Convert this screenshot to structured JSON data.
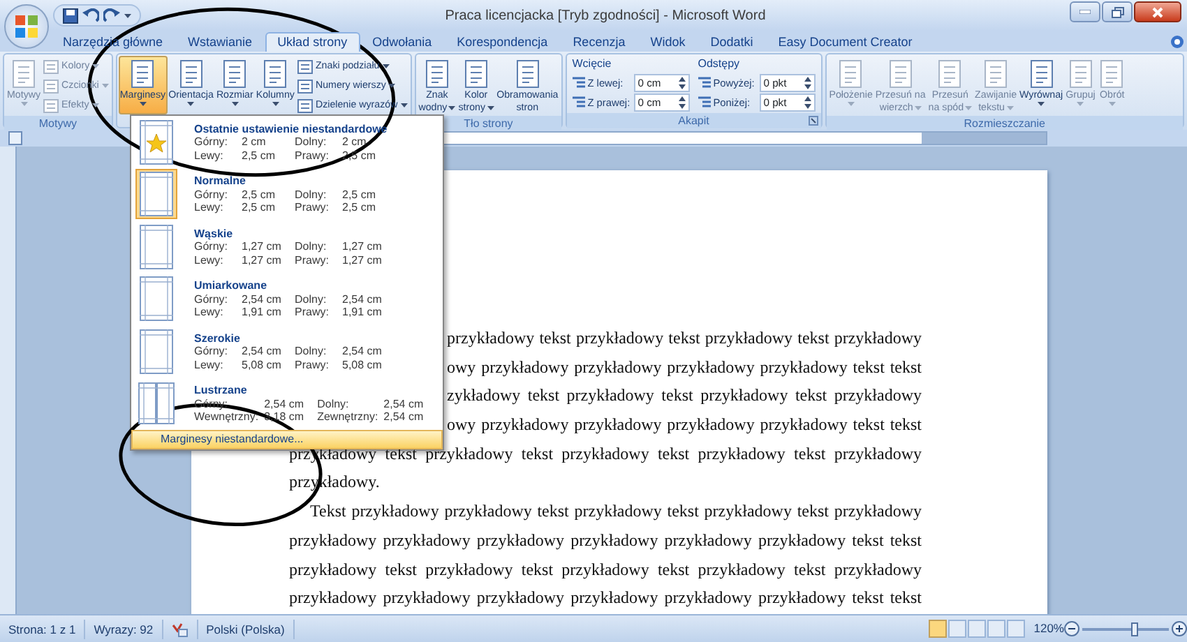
{
  "window": {
    "title": "Praca licencjacka [Tryb zgodności] - Microsoft Word"
  },
  "tabs": [
    {
      "label": "Narzędzia główne",
      "selected": false
    },
    {
      "label": "Wstawianie",
      "selected": false
    },
    {
      "label": "Układ strony",
      "selected": true
    },
    {
      "label": "Odwołania",
      "selected": false
    },
    {
      "label": "Korespondencja",
      "selected": false
    },
    {
      "label": "Recenzja",
      "selected": false
    },
    {
      "label": "Widok",
      "selected": false
    },
    {
      "label": "Dodatki",
      "selected": false
    },
    {
      "label": "Easy Document Creator",
      "selected": false
    }
  ],
  "ribbon": {
    "groups": [
      {
        "label": "Motywy",
        "items": [
          {
            "kind": "large",
            "lines": [
              "Motywy"
            ],
            "dropdown": true,
            "disabled": true,
            "selected": false
          },
          {
            "kind": "stack",
            "items": [
              {
                "label": "Kolory",
                "dropdown": true,
                "disabled": true
              },
              {
                "label": "Czcionki",
                "dropdown": true,
                "disabled": true
              },
              {
                "label": "Efekty",
                "dropdown": true,
                "disabled": true
              }
            ]
          }
        ]
      },
      {
        "items": [
          {
            "kind": "large",
            "lines": [
              "Marginesy"
            ],
            "dropdown": true,
            "disabled": false,
            "selected": true
          },
          {
            "kind": "large",
            "lines": [
              "Orientacja"
            ],
            "dropdown": true,
            "disabled": false,
            "selected": false
          },
          {
            "kind": "large",
            "lines": [
              "Rozmiar"
            ],
            "dropdown": true,
            "disabled": false,
            "selected": false
          },
          {
            "kind": "large",
            "lines": [
              "Kolumny"
            ],
            "dropdown": true,
            "disabled": false,
            "selected": false
          },
          {
            "kind": "stack",
            "items": [
              {
                "label": "Znaki podziału",
                "dropdown": true,
                "disabled": false
              },
              {
                "label": "Numery wierszy",
                "dropdown": true,
                "disabled": false
              },
              {
                "label": "Dzielenie wyrazów",
                "dropdown": true,
                "disabled": false
              }
            ]
          }
        ]
      },
      {
        "label": "Tło strony",
        "items": [
          {
            "kind": "large",
            "lines": [
              "Znak",
              "wodny"
            ],
            "dropdown": true,
            "disabled": false,
            "selected": false
          },
          {
            "kind": "large",
            "lines": [
              "Kolor",
              "strony"
            ],
            "dropdown": true,
            "disabled": false,
            "selected": false
          },
          {
            "kind": "large",
            "lines": [
              "Obramowania",
              "stron"
            ],
            "dropdown": false,
            "disabled": false,
            "selected": false
          }
        ]
      },
      {
        "label": "Akapit",
        "launcher": true,
        "items": [
          {
            "kind": "spins",
            "heading": "Wcięcie",
            "items": [
              {
                "label": "Z lewej:",
                "value": "0 cm"
              },
              {
                "label": "Z prawej:",
                "value": "0 cm"
              }
            ]
          },
          {
            "kind": "spins",
            "heading": "Odstępy",
            "items": [
              {
                "label": "Powyżej:",
                "value": "0 pkt"
              },
              {
                "label": "Poniżej:",
                "value": "0 pkt"
              }
            ]
          }
        ]
      },
      {
        "label": "Rozmieszczanie",
        "items": [
          {
            "kind": "large",
            "lines": [
              "Położenie"
            ],
            "dropdown": true,
            "disabled": true,
            "selected": false
          },
          {
            "kind": "large",
            "lines": [
              "Przesuń na",
              "wierzch"
            ],
            "dropdown": true,
            "disabled": true,
            "selected": false
          },
          {
            "kind": "large",
            "lines": [
              "Przesuń",
              "na spód"
            ],
            "dropdown": true,
            "disabled": true,
            "selected": false
          },
          {
            "kind": "large",
            "lines": [
              "Zawijanie",
              "tekstu"
            ],
            "dropdown": true,
            "disabled": true,
            "selected": false
          },
          {
            "kind": "large",
            "lines": [
              "Wyrównaj"
            ],
            "dropdown": true,
            "disabled": false,
            "selected": false
          },
          {
            "kind": "large",
            "lines": [
              "Grupuj"
            ],
            "dropdown": true,
            "disabled": true,
            "selected": false
          },
          {
            "kind": "large",
            "lines": [
              "Obrót"
            ],
            "dropdown": true,
            "disabled": true,
            "selected": false
          }
        ]
      }
    ]
  },
  "margins_menu": {
    "items": [
      {
        "kind": "star",
        "title": "Ostatnie ustawienie niestandardowe",
        "selected": false,
        "rows": [
          [
            "Górny:",
            "2 cm",
            "Dolny:",
            "2 cm"
          ],
          [
            "Lewy:",
            "2,5 cm",
            "Prawy:",
            "2,5 cm"
          ]
        ]
      },
      {
        "kind": "page",
        "title": "Normalne",
        "selected": true,
        "rows": [
          [
            "Górny:",
            "2,5 cm",
            "Dolny:",
            "2,5 cm"
          ],
          [
            "Lewy:",
            "2,5 cm",
            "Prawy:",
            "2,5 cm"
          ]
        ]
      },
      {
        "kind": "page",
        "title": "Wąskie",
        "selected": false,
        "rows": [
          [
            "Górny:",
            "1,27 cm",
            "Dolny:",
            "1,27 cm"
          ],
          [
            "Lewy:",
            "1,27 cm",
            "Prawy:",
            "1,27 cm"
          ]
        ]
      },
      {
        "kind": "page",
        "title": "Umiarkowane",
        "selected": false,
        "rows": [
          [
            "Górny:",
            "2,54 cm",
            "Dolny:",
            "2,54 cm"
          ],
          [
            "Lewy:",
            "1,91 cm",
            "Prawy:",
            "1,91 cm"
          ]
        ]
      },
      {
        "kind": "page",
        "title": "Szerokie",
        "selected": false,
        "rows": [
          [
            "Górny:",
            "2,54 cm",
            "Dolny:",
            "2,54 cm"
          ],
          [
            "Lewy:",
            "5,08 cm",
            "Prawy:",
            "5,08 cm"
          ]
        ]
      },
      {
        "kind": "mirror",
        "title": "Lustrzane",
        "selected": false,
        "rows": [
          [
            "Górny:",
            "2,54 cm",
            "Dolny:",
            "2,54 cm"
          ],
          [
            "Wewnętrzny:",
            "3,18 cm",
            "Zewnętrzny:",
            "2,54 cm"
          ]
        ]
      }
    ],
    "footer": {
      "label": "Marginesy niestandardowe...",
      "selected": true
    }
  },
  "document": {
    "lines": [
      {
        "kind": "clipped",
        "text": "przykładowy tekst przykładowy tekst przykładowy tekst przykładowy"
      },
      {
        "kind": "clipped",
        "text": "owy przykładowy przykładowy przykładowy przykładowy tekst tekst"
      },
      {
        "kind": "clipped",
        "text": "zykładowy tekst przykładowy tekst przykładowy tekst przykładowy"
      },
      {
        "kind": "clipped",
        "text": "owy przykładowy przykładowy przykładowy przykładowy tekst tekst"
      },
      {
        "kind": "full",
        "text": "przykładowy tekst przykładowy tekst przykładowy tekst przykładowy tekst przykładowy"
      },
      {
        "kind": "end",
        "text": "przykładowy."
      },
      {
        "kind": "first",
        "text": "Tekst przykładowy przykładowy tekst przykładowy tekst przykładowy tekst przykładowy"
      },
      {
        "kind": "full",
        "text": "przykładowy przykładowy przykładowy przykładowy przykładowy przykładowy tekst tekst"
      },
      {
        "kind": "full",
        "text": "przykładowy tekst przykładowy tekst przykładowy tekst przykładowy tekst przykładowy"
      },
      {
        "kind": "full",
        "text": "przykładowy przykładowy przykładowy przykładowy przykładowy przykładowy tekst tekst"
      }
    ]
  },
  "status_bar": {
    "page": "Strona: 1 z 1",
    "words": "Wyrazy: 92",
    "language": "Polski (Polska)",
    "zoom": {
      "reading": "120%",
      "level": 0.6
    }
  }
}
